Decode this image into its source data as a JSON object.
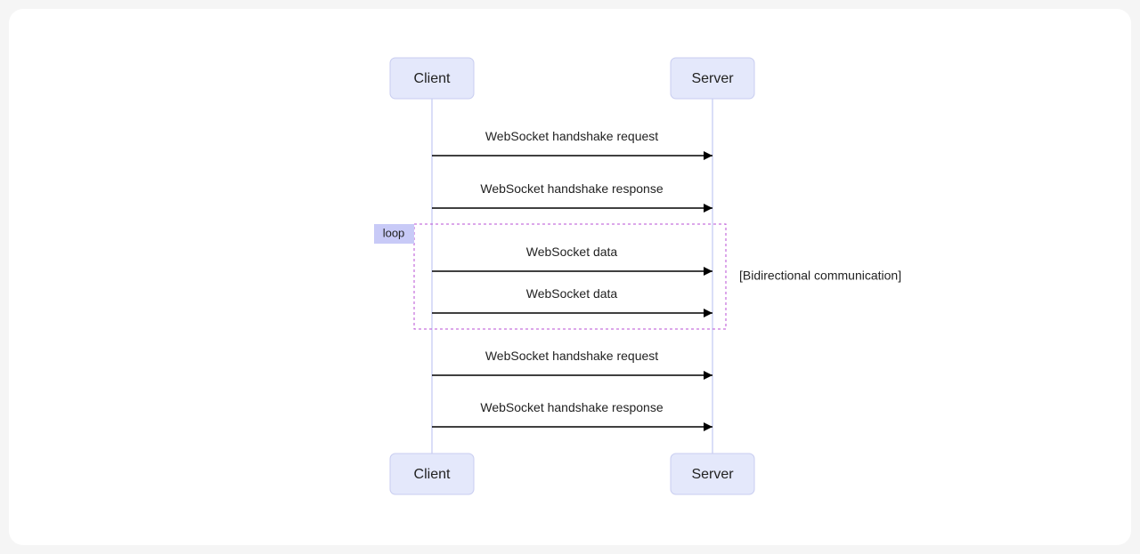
{
  "diagram": {
    "type": "sequence",
    "actors": {
      "client": "Client",
      "server": "Server"
    },
    "messages": {
      "m1": "WebSocket handshake request",
      "m2": "WebSocket handshake response",
      "m3": "WebSocket data",
      "m4": "WebSocket data",
      "m5": "WebSocket handshake request",
      "m6": "WebSocket handshake response"
    },
    "loop": {
      "tag": "loop",
      "note": "[Bidirectional communication]"
    }
  }
}
